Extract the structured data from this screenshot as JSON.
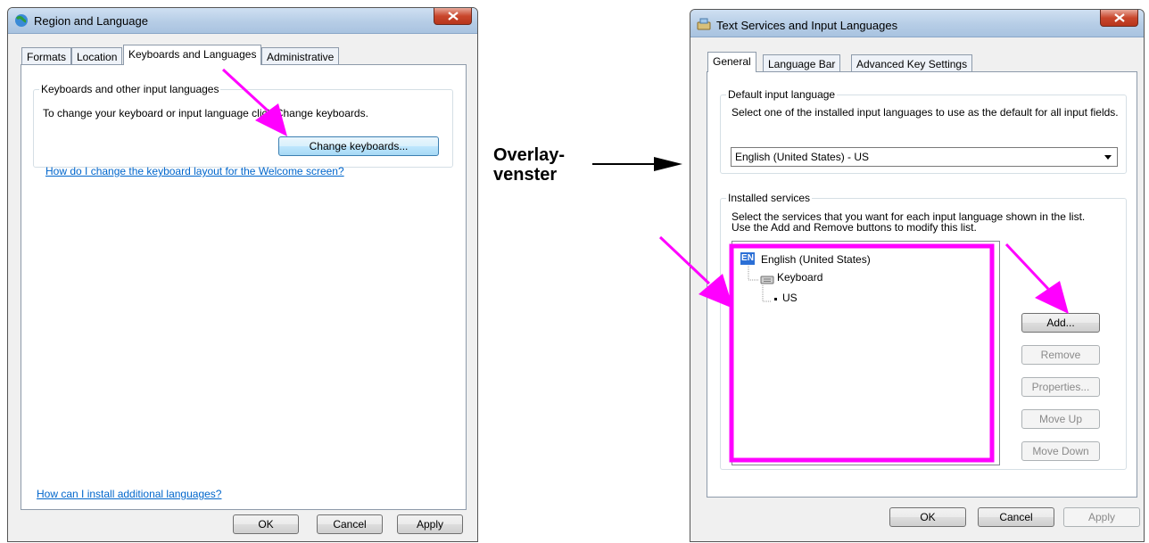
{
  "left_window": {
    "title": "Region and Language",
    "tabs": [
      "Formats",
      "Location",
      "Keyboards and Languages",
      "Administrative"
    ],
    "group_title": "Keyboards and other input languages",
    "group_text": "To change your keyboard or input language click Change keyboards.",
    "change_keyboards_label": "Change keyboards...",
    "welcome_link": "How do I change the keyboard layout for the Welcome screen?",
    "install_link": "How can I install additional languages?",
    "ok_label": "OK",
    "cancel_label": "Cancel",
    "apply_label": "Apply"
  },
  "annotation": {
    "line1": "Overlay-",
    "line2": "venster"
  },
  "right_window": {
    "title": "Text Services and Input Languages",
    "tabs": [
      "General",
      "Language Bar",
      "Advanced Key Settings"
    ],
    "default_group_title": "Default input language",
    "default_text": "Select one of the installed input languages to use as the default for all input fields.",
    "default_select_value": "English (United States) - US",
    "services_group_title": "Installed services",
    "services_text_line1": "Select the services that you want for each input language shown in the list.",
    "services_text_line2": "Use the Add and Remove buttons to modify this list.",
    "tree": {
      "language_badge": "EN",
      "language": "English (United States)",
      "category": "Keyboard",
      "layout": "US"
    },
    "buttons": {
      "add": "Add...",
      "remove": "Remove",
      "properties": "Properties...",
      "move_up": "Move Up",
      "move_down": "Move Down"
    },
    "ok_label": "OK",
    "cancel_label": "Cancel",
    "apply_label": "Apply"
  },
  "colors": {
    "highlight": "#ff00ff",
    "link": "#0066cc",
    "close_button": "#c9462c"
  }
}
